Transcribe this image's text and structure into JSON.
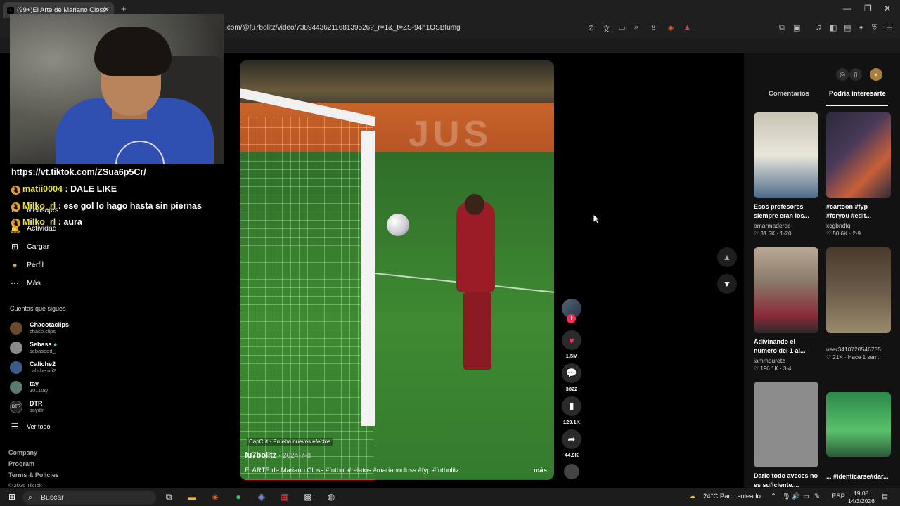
{
  "browser": {
    "tab_title": "(99+)El Arte de Mariano Closs",
    "tab_close": "✕",
    "new_tab": "+",
    "url": ".com/@fu7bolitz/video/7389443621168139526?_r=1&_t=ZS-94h1OSBfumg",
    "window_controls": [
      "—",
      "❐",
      "✕"
    ]
  },
  "chat": [
    {
      "user": "",
      "text": "https://vt.tiktok.com/ZSua6p5Cr/"
    },
    {
      "user": "matii0004",
      "text": ": DALE LIKE"
    },
    {
      "user": "Milko_rl",
      "text": ": ese gol lo hago hasta sin piernas"
    },
    {
      "user": "Milko_rl",
      "text": ": aura"
    }
  ],
  "leftnav": {
    "items": [
      {
        "icon": "✉",
        "label": "Mensajes"
      },
      {
        "icon": "🔔",
        "label": "Actividad"
      },
      {
        "icon": "⊞",
        "label": "Cargar"
      },
      {
        "icon": "●",
        "label": "Perfil"
      },
      {
        "icon": "⋯",
        "label": "Más"
      }
    ],
    "following_title": "Cuentas que sigues",
    "accounts": [
      {
        "name": "Chacotaclips",
        "handle": "chaco.clips"
      },
      {
        "name": "Sebass",
        "handle": "sebaspod_"
      },
      {
        "name": "Caliche2",
        "handle": "caliche.ofi2"
      },
      {
        "name": "tay",
        "handle": "1011tay"
      },
      {
        "name": "DTR",
        "handle": "soydtr"
      }
    ],
    "see_all": "Ver todo",
    "footer": [
      "Company",
      "Program",
      "Terms & Policies"
    ],
    "copyright": "© 2026 TikTok"
  },
  "video": {
    "capcut": "CapCut · Prueba nuevos efectos",
    "username": "fu7bolitz",
    "date": " · 2024-7-8",
    "description": "El ARTE de Mariano Closs #futbol #relatos #marianocloss #fyp #futbolitz",
    "more": "más",
    "progress": 0.43
  },
  "actions": {
    "likes": "1.5M",
    "comments": "3822",
    "saves": "129.1K",
    "shares": "44.9K"
  },
  "rightpanel": {
    "tabs": [
      "Comentarios",
      "Podría interesarte"
    ],
    "cards": [
      {
        "title": "Esos profesores siempre eran los...",
        "author": "omarmaderoc",
        "likes": "31.5K",
        "meta": "1-20",
        "thumb_colors": [
          "#c9c4b4",
          "#4d6a8a"
        ]
      },
      {
        "title": "#cartoon #fyp #foryou #edit...",
        "author": "xcgbndtq",
        "likes": "50.6K",
        "meta": "2-9",
        "thumb_colors": [
          "#2a2a3a",
          "#6a4a3a"
        ]
      },
      {
        "title": "Adivinando el numero del 1 al...",
        "author": "iammouretz",
        "likes": "196.1K",
        "meta": "3-4",
        "thumb_colors": [
          "#9a8a7a",
          "#8a2a3a"
        ]
      },
      {
        "title": "",
        "author": "user3410720546735",
        "likes": "21K",
        "meta": "Hace 1 sem.",
        "thumb_colors": [
          "#4a3a2a",
          "#8a7a5a"
        ]
      },
      {
        "title": "Darlo todo aveces no es suficiente....",
        "author": "",
        "likes": "",
        "meta": "",
        "thumb_colors": [
          "#8a8a8a",
          "#6a6a6a"
        ]
      },
      {
        "title": "... #identicarse#dar...",
        "author": "",
        "likes": "",
        "meta": "",
        "thumb_colors": [
          "#2a8a4a",
          "#4ab05a"
        ]
      }
    ]
  },
  "taskbar": {
    "search_placeholder": "Buscar",
    "weather": "24°C  Parc. soleado",
    "lang": "ESP",
    "time": "19:08",
    "date": "14/3/2026"
  }
}
